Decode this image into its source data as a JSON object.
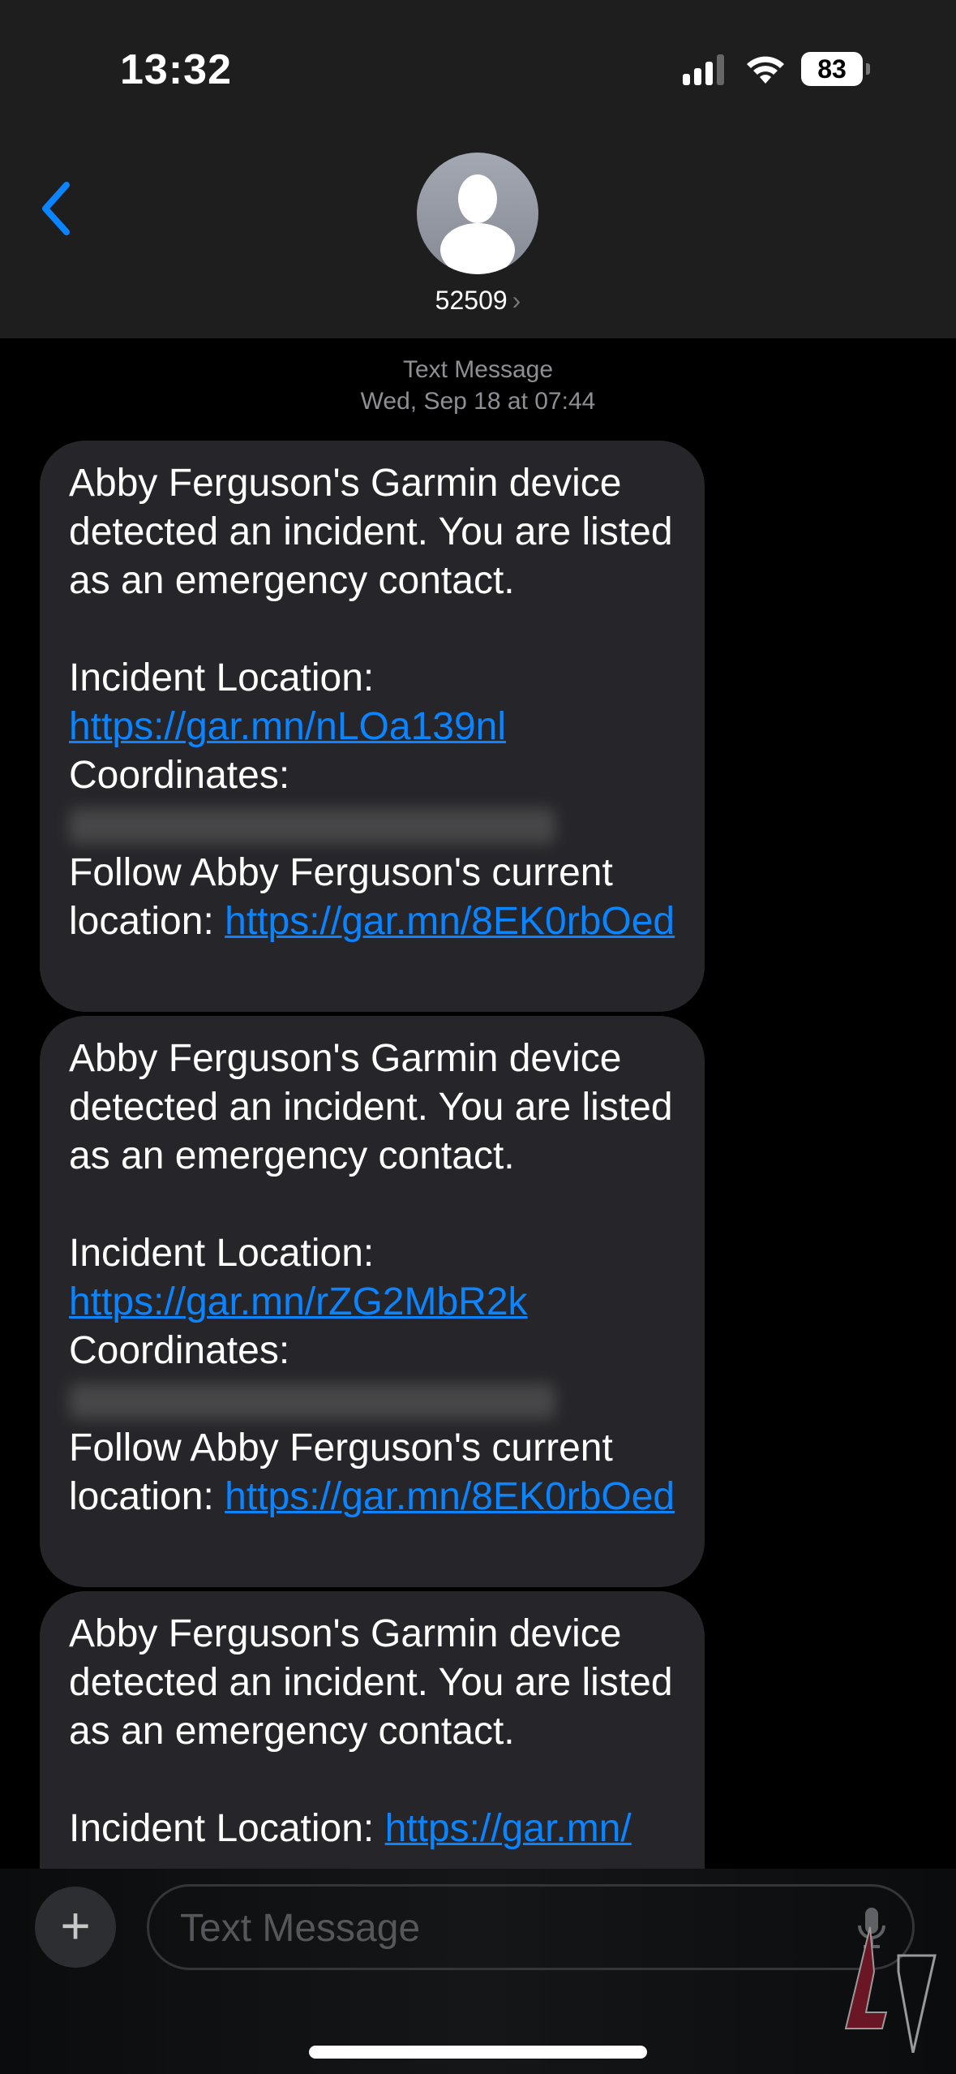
{
  "status_bar": {
    "time": "13:32",
    "battery": "83",
    "icons": [
      "signal-icon",
      "wifi-icon",
      "battery-icon"
    ]
  },
  "header": {
    "contact": "52509",
    "back_icon": "chevron-left-icon",
    "avatar_icon": "person-icon"
  },
  "thread": {
    "service": "Text Message",
    "date": "Wed, Sep 18 at 07:44"
  },
  "messages": [
    {
      "intro": "Abby Ferguson's Garmin device detected an incident. You are listed as an emergency contact.",
      "incident_label": "Incident Location: ",
      "incident_link": "https://gar.mn/nLOa139nl",
      "coords_label": "Coordinates:",
      "follow_label": "Follow Abby Ferguson's current location: ",
      "follow_link": "https://gar.mn/8EK0rbOed"
    },
    {
      "intro": "Abby Ferguson's Garmin device detected an incident. You are listed as an emergency contact.",
      "incident_label": "Incident Location: ",
      "incident_link": "https://gar.mn/rZG2MbR2k",
      "coords_label": "Coordinates:",
      "follow_label": "Follow Abby Ferguson's current location: ",
      "follow_link": "https://gar.mn/8EK0rbOed"
    },
    {
      "intro": "Abby Ferguson's Garmin device detected an incident. You are listed as an emergency contact.",
      "incident_label": "Incident Location: ",
      "incident_link": "https://gar.mn/"
    }
  ],
  "composer": {
    "placeholder": "Text Message",
    "add_icon": "plus-icon",
    "mic_icon": "microphone-icon"
  },
  "colors": {
    "link": "#0a84ff",
    "bubble": "#26262a",
    "accent": "#0a84ff"
  }
}
